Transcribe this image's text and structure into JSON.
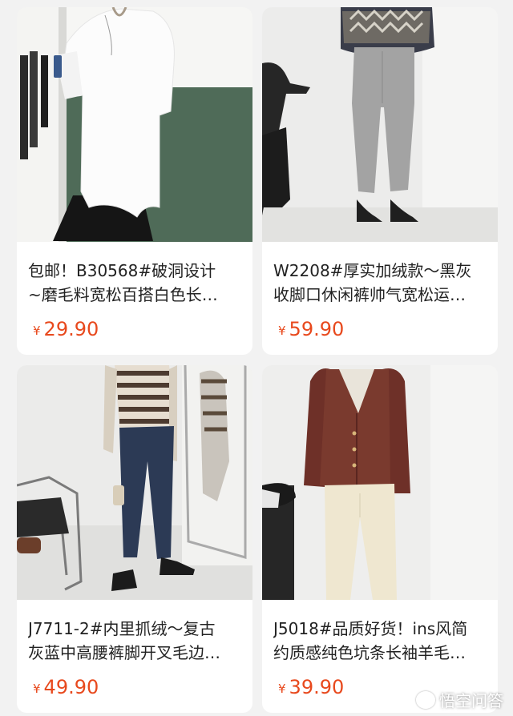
{
  "products": [
    {
      "title_line1": "包邮！B30568#破洞设计",
      "title_line2": "~磨毛料宽松百搭白色长…",
      "currency": "¥",
      "price": "29.90"
    },
    {
      "title_line1": "W2208#厚实加绒款～黑灰",
      "title_line2": "收脚口休闲裤帅气宽松运…",
      "currency": "¥",
      "price": "59.90"
    },
    {
      "title_line1": "J7711-2#内里抓绒～复古",
      "title_line2": "灰蓝中高腰裤脚开叉毛边…",
      "currency": "¥",
      "price": "49.90"
    },
    {
      "title_line1": "J5018#品质好货！ins风简",
      "title_line2": "约质感纯色坑条长袖羊毛…",
      "currency": "¥",
      "price": "39.90"
    }
  ],
  "watermark": {
    "text": "悟空问答",
    "icon": "wukong-logo-icon"
  },
  "colors": {
    "price": "#e8491d",
    "background": "#f2f2f2",
    "card": "#ffffff"
  }
}
